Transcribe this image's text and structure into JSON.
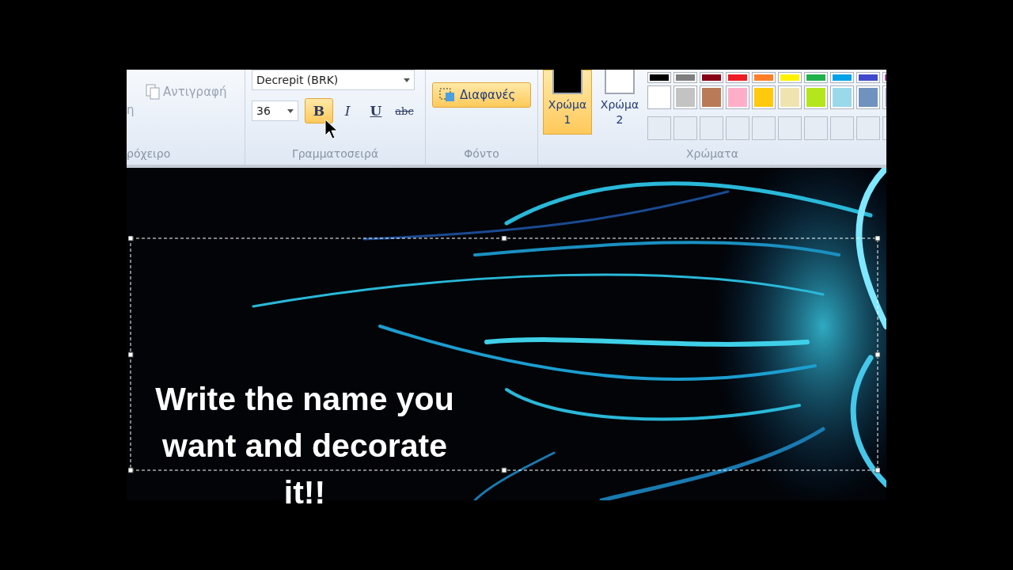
{
  "clipboard": {
    "paste_label": "η",
    "items": [
      {
        "label": "Αντιγραφή"
      }
    ],
    "group_label": "ρόχειρο"
  },
  "font": {
    "family": "Decrepit (BRK)",
    "size": "36",
    "styles": [
      {
        "kind": "bold",
        "label": "B",
        "selected": true
      },
      {
        "kind": "italic",
        "label": "I",
        "selected": false
      },
      {
        "kind": "underline",
        "label": "U",
        "selected": false
      },
      {
        "kind": "strikethrough",
        "label": "abc",
        "selected": false
      }
    ],
    "group_label": "Γραμματοσειρά"
  },
  "background": {
    "options": [
      {
        "label": "Διαφανές",
        "selected": true
      }
    ],
    "group_label": "Φόντο"
  },
  "colors": {
    "slots": [
      {
        "label": "Χρώμα 1",
        "color": "#000000",
        "selected": true
      },
      {
        "label": "Χρώμα 2",
        "color": "#ffffff",
        "selected": false
      }
    ],
    "palette": [
      {
        "color": "#000000"
      },
      {
        "color": "#7f7f7f"
      },
      {
        "color": "#880015"
      },
      {
        "color": "#ed1c24"
      },
      {
        "color": "#ff7f27"
      },
      {
        "color": "#fff200"
      },
      {
        "color": "#22b14c"
      },
      {
        "color": "#00a2e8"
      },
      {
        "color": "#3f48cc"
      },
      {
        "color": "#a349a4"
      },
      {
        "color": "#ffffff"
      },
      {
        "color": "#c3c3c3"
      },
      {
        "color": "#b97a57"
      },
      {
        "color": "#ffaec9"
      },
      {
        "color": "#ffc90e"
      },
      {
        "color": "#efe4b0"
      },
      {
        "color": "#b5e61d"
      },
      {
        "color": "#99d9ea"
      },
      {
        "color": "#7092be"
      },
      {
        "color": "#c8bfe7"
      }
    ],
    "group_label": "Χρώματα"
  },
  "caption": "Write the name you want and decorate it!!"
}
